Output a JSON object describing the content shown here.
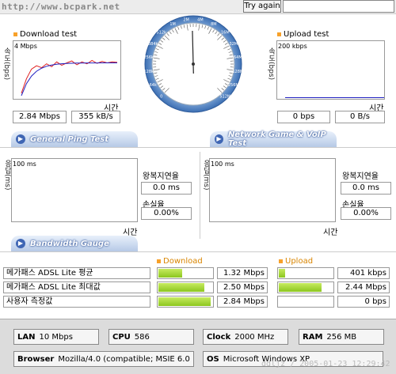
{
  "header": {
    "url": "http://www.bcpark.net",
    "try_again": "Try again"
  },
  "download": {
    "title": "Download test",
    "axis_label": "속도(bps)",
    "scale": "4 Mbps",
    "time_label": "시간",
    "mbps": "2.84 Mbps",
    "kbs": "355 kB/s"
  },
  "upload": {
    "title": "Upload test",
    "axis_label": "속도(bps)",
    "scale": "200 kbps",
    "time_label": "시간",
    "bps": "0 bps",
    "bs": "0 B/s"
  },
  "gauge": {
    "ticks": [
      "0",
      "64k",
      "128k",
      "256k",
      "384k",
      "512k",
      "1M",
      "2M",
      "4M",
      "8M",
      "16M",
      "32M",
      "64M",
      "128M",
      "256M",
      "512M"
    ],
    "needle_value": "2.84 Mbps"
  },
  "tabs": {
    "ping": "General Ping Test",
    "game": "Network Game & VoIP Test",
    "bandwidth": "Bandwidth Gauge"
  },
  "ping": {
    "axis_label": "응답(ms)",
    "scale": "100 ms",
    "time_label": "시간",
    "delay_label": "왕복지연율",
    "delay_value": "0.0 ms",
    "loss_label": "손실율",
    "loss_value": "0.00%"
  },
  "game": {
    "axis_label": "응답(ms)",
    "scale": "100 ms",
    "time_label": "시간",
    "delay_label": "왕복지연율",
    "delay_value": "0.0 ms",
    "loss_label": "손실율",
    "loss_value": "0.00%"
  },
  "bandwidth": {
    "download_header": "Download",
    "upload_header": "Upload",
    "rows": [
      {
        "label": "메가패스 ADSL Lite 평균",
        "down": "1.32 Mbps",
        "down_fill": 0.46,
        "up": "401 kbps",
        "up_fill": 0.12
      },
      {
        "label": "메가패스 ADSL Lite 최대값",
        "down": "2.50 Mbps",
        "down_fill": 0.88,
        "up": "2.44 Mbps",
        "up_fill": 0.82
      },
      {
        "label": "사용자 측정값",
        "down": "2.84 Mbps",
        "down_fill": 1.0,
        "up": "0 bps",
        "up_fill": 0.0
      }
    ]
  },
  "system": {
    "lan_label": "LAN",
    "lan": "10 Mbps",
    "cpu_label": "CPU",
    "cpu": "586",
    "clock_label": "Clock",
    "clock": "2000 MHz",
    "ram_label": "RAM",
    "ram": "256 MB",
    "browser_label": "Browser",
    "browser": "Mozilla/4.0 (compatible; MSIE 6.0",
    "os_label": "OS",
    "os": "Microsoft Windows XP",
    "stamp": "ddljz / 2005-01-23 12:29:42"
  },
  "colors": {
    "accent": "#f7a12a",
    "tab_blue": "#3f66b4",
    "line_red": "#e02020",
    "line_blue": "#2020c0",
    "bar_green": "#8cc61f"
  }
}
